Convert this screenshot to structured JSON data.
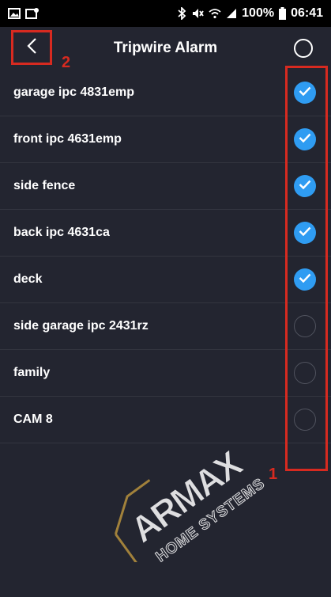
{
  "status_bar": {
    "left_icons": [
      "gallery-icon",
      "notification-image-icon"
    ],
    "right_icons": [
      "bluetooth-icon",
      "mute-icon",
      "wifi-icon",
      "signal-icon"
    ],
    "battery": "100%",
    "time": "06:41"
  },
  "header": {
    "title": "Tripwire Alarm",
    "back_icon": "chevron-left-icon",
    "select_all_icon": "circle-outline-icon"
  },
  "annotations": {
    "list_marker": "1",
    "back_marker": "2",
    "marker_color": "#d72a20"
  },
  "cameras": [
    {
      "name": "garage ipc 4831emp",
      "checked": true
    },
    {
      "name": "front ipc 4631emp",
      "checked": true
    },
    {
      "name": "side fence",
      "checked": true
    },
    {
      "name": "back ipc 4631ca",
      "checked": true
    },
    {
      "name": "deck",
      "checked": true
    },
    {
      "name": "side garage ipc 2431rz",
      "checked": false
    },
    {
      "name": "family",
      "checked": false
    },
    {
      "name": "CAM 8",
      "checked": false
    }
  ],
  "watermark": {
    "brand": "ARMAX",
    "tagline": "HOME SYSTEMS"
  },
  "colors": {
    "background": "#232530",
    "status_bar": "#000000",
    "accent": "#2f9cf2",
    "divider": "#33353f"
  }
}
